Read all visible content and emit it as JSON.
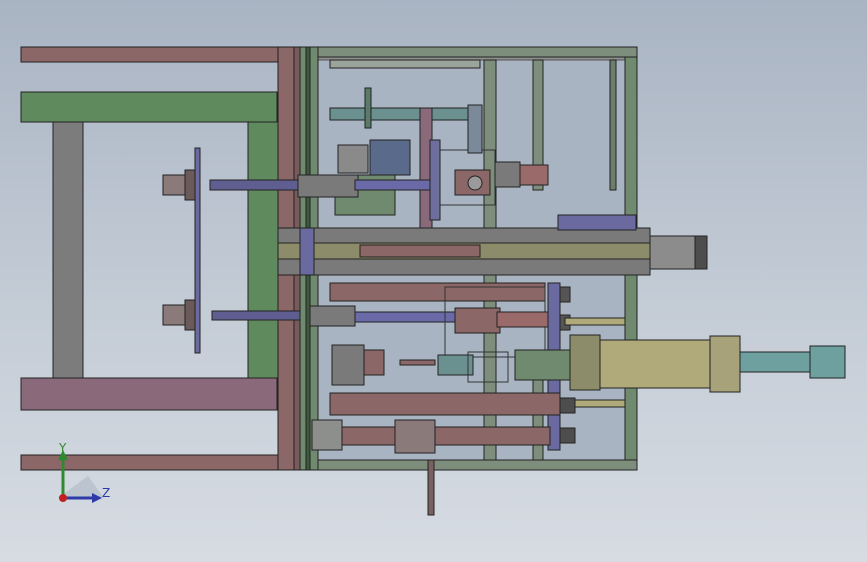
{
  "viewport": {
    "background_top": "#a9b4c3",
    "background_bottom": "#d7dce3"
  },
  "triad": {
    "y_label": "Y",
    "z_label": "Z",
    "y_color": "#2f8a2f",
    "z_color": "#2d3aa8",
    "origin_color": "#c02020"
  }
}
